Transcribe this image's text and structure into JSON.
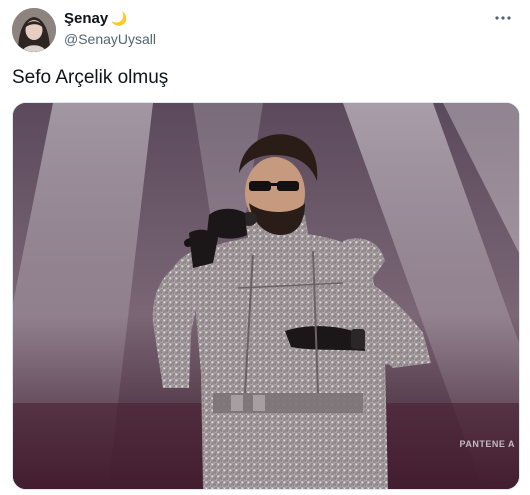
{
  "tweet": {
    "display_name": "Şenay",
    "name_emoji": "🌙",
    "handle": "@SenayUysall",
    "more_icon": "more-dots-icon",
    "text": "Sefo Arçelik olmuş",
    "media": {
      "watermark": "PANTENE A"
    }
  }
}
